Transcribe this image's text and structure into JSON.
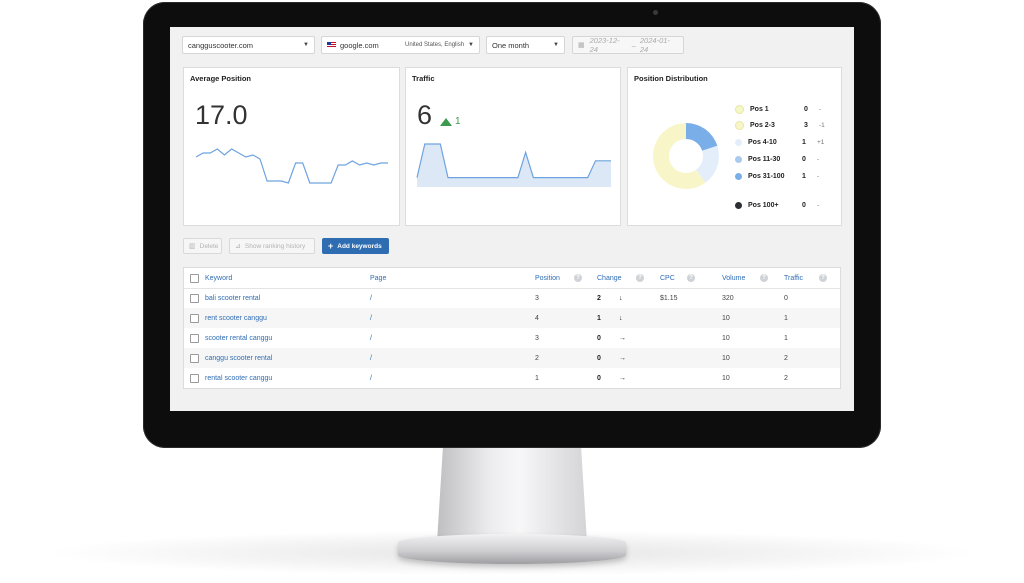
{
  "toolbar": {
    "domain_select": "cangguscooter.com",
    "engine_select": "google.com",
    "locale": "United States, English",
    "period_select": "One month",
    "date_from": "2023-12-24",
    "date_separator": "–",
    "date_to": "2024-01-24"
  },
  "cards": {
    "avg_position": {
      "title": "Average Position",
      "value": "17.0"
    },
    "traffic": {
      "title": "Traffic",
      "value": "6",
      "delta": "1"
    },
    "distribution": {
      "title": "Position Distribution",
      "items": [
        {
          "label": "Pos 1",
          "count": "0",
          "change": "-",
          "color": "#f4f8c4"
        },
        {
          "label": "Pos 2-3",
          "count": "3",
          "change": "-1",
          "color": "#f8f6c9"
        },
        {
          "label": "Pos 4-10",
          "count": "1",
          "change": "+1",
          "color": "#e4eefa"
        },
        {
          "label": "Pos 11-30",
          "count": "0",
          "change": "-",
          "color": "#a9c9ef"
        },
        {
          "label": "Pos 31-100",
          "count": "1",
          "change": "-",
          "color": "#7aaee8"
        },
        {
          "label": "Pos 100+",
          "count": "0",
          "change": "-",
          "color": "#2c2f33"
        }
      ]
    }
  },
  "actions": {
    "delete": "Delete",
    "history": "Show ranking history",
    "add": "Add keywords"
  },
  "table": {
    "headers": {
      "keyword": "Keyword",
      "page": "Page",
      "position": "Position",
      "change": "Change",
      "cpc": "CPC",
      "volume": "Volume",
      "traffic": "Traffic",
      "help": "?"
    },
    "rows": [
      {
        "keyword": "bali scooter rental",
        "page": "/",
        "position": "3",
        "change": "2",
        "arrow": "↓",
        "cpc": "$1.15",
        "volume": "320",
        "traffic": "0"
      },
      {
        "keyword": "rent scooter canggu",
        "page": "/",
        "position": "4",
        "change": "1",
        "arrow": "↓",
        "cpc": "",
        "volume": "10",
        "traffic": "1"
      },
      {
        "keyword": "scooter rental canggu",
        "page": "/",
        "position": "3",
        "change": "0",
        "arrow": "→",
        "cpc": "",
        "volume": "10",
        "traffic": "1"
      },
      {
        "keyword": "canggu scooter rental",
        "page": "/",
        "position": "2",
        "change": "0",
        "arrow": "→",
        "cpc": "",
        "volume": "10",
        "traffic": "2"
      },
      {
        "keyword": "rental scooter canggu",
        "page": "/",
        "position": "1",
        "change": "0",
        "arrow": "→",
        "cpc": "",
        "volume": "10",
        "traffic": "2"
      }
    ]
  },
  "chart_data": [
    {
      "type": "line",
      "name": "avg_position_sparkline",
      "values": [
        14,
        12,
        12,
        10,
        13,
        10,
        12,
        14,
        13,
        15,
        26,
        26,
        26,
        27,
        17,
        17,
        27,
        27,
        27,
        27,
        18,
        18,
        16,
        18,
        17,
        18,
        17,
        17
      ],
      "grid": false
    },
    {
      "type": "area",
      "name": "traffic_sparkline",
      "values": [
        1,
        5,
        5,
        5,
        1,
        1,
        1,
        1,
        1,
        1,
        1,
        1,
        1,
        1,
        4,
        1,
        1,
        1,
        1,
        1,
        1,
        1,
        1,
        3,
        3,
        3
      ],
      "grid": false
    },
    {
      "type": "pie",
      "name": "position_distribution_donut",
      "categories": [
        "Pos 2-3",
        "Pos 4-10",
        "Pos 31-100"
      ],
      "values": [
        3,
        1,
        1
      ],
      "colors": [
        "#f8f6c9",
        "#e4eefa",
        "#7aaee8"
      ]
    }
  ]
}
